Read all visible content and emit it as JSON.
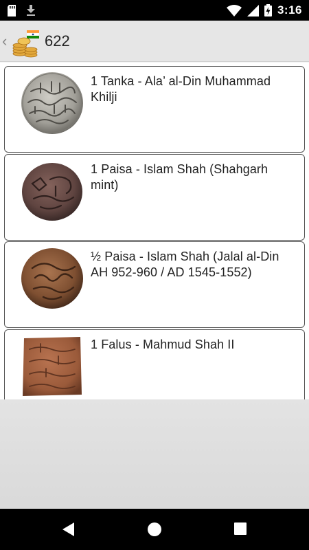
{
  "status_bar": {
    "time": "3:16",
    "icons": [
      "sd-card-icon",
      "download-icon",
      "wifi-icon",
      "cell-signal-icon",
      "battery-charging-icon"
    ]
  },
  "app_bar": {
    "title": "622",
    "flag_colors": [
      "#FF9933",
      "#FFFFFF",
      "#138808"
    ],
    "coin_color": "#e3a93c"
  },
  "coins": [
    {
      "name": "1 Tanka - Ala’ al-Din Muhammad Khilji",
      "image": "silver-round-coin",
      "color": "#a8a6a0"
    },
    {
      "name": "1 Paisa - Islam Shah (Shahgarh mint)",
      "image": "dark-copper-round-coin",
      "color": "#6b4c46"
    },
    {
      "name": "½ Paisa - Islam Shah (Jalal al-Din AH 952-960 / AD 1545-1552)",
      "image": "bronze-round-coin",
      "color": "#8a5838"
    },
    {
      "name": "1 Falus - Mahmud Shah II",
      "image": "copper-square-coin",
      "color": "#a0603f"
    }
  ],
  "nav_bar": {
    "buttons": [
      "back-button",
      "home-button",
      "recents-button"
    ]
  }
}
